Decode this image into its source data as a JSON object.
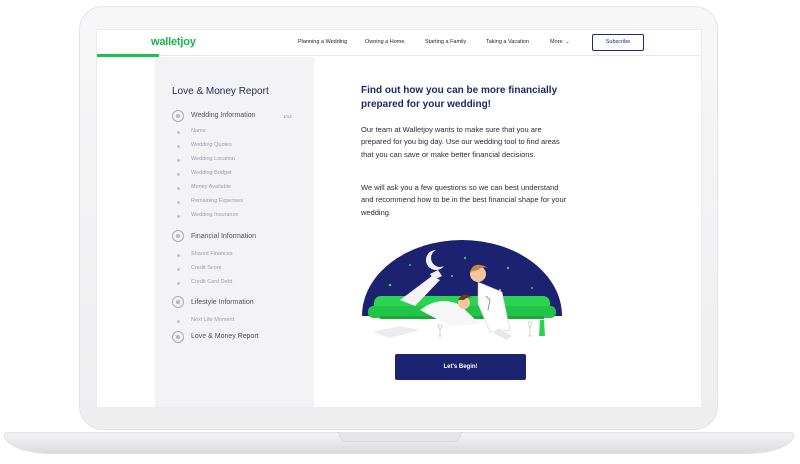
{
  "header": {
    "logo": "walletjoy",
    "nav": [
      "Planning a Wedding",
      "Owning a Home",
      "Starting a Family",
      "Taking a Vacation"
    ],
    "more_label": "More",
    "subscribe_label": "Subscribe"
  },
  "sidebar": {
    "title": "Love & Money Report",
    "progress": "1/14",
    "sections": [
      {
        "label": "Wedding Information",
        "items": [
          "Name",
          "Wedding Quotes",
          "Wedding Location",
          "Wedding Budget",
          "Money Available",
          "Remaining Expenses",
          "Wedding Insurance"
        ]
      },
      {
        "label": "Financial Information",
        "items": [
          "Shared Finances",
          "Credit Score",
          "Credit Card Debt"
        ]
      },
      {
        "label": "Lifestyle Information",
        "items": [
          "Next Life Moment"
        ]
      },
      {
        "label": "Love & Money Report",
        "items": []
      }
    ]
  },
  "main": {
    "headline": "Find out how you can be more financially prepared for your wedding!",
    "paragraph1": "Our team at Walletjoy wants to make sure that you are prepared for you big day. Use our wedding tool to find areas that you can save or make better financial decisions.",
    "paragraph2": "We will ask you a few questions so we can best understand and recommend how to be in the best financial shape for your wedding.",
    "cta_label": "Let's Begin!"
  },
  "colors": {
    "brand_green": "#1ab34a",
    "navy": "#1b2470",
    "sofa_green": "#2bd44f"
  },
  "icons": {
    "nav_more": "chevron-down-icon",
    "section": "step-circle-icon"
  }
}
